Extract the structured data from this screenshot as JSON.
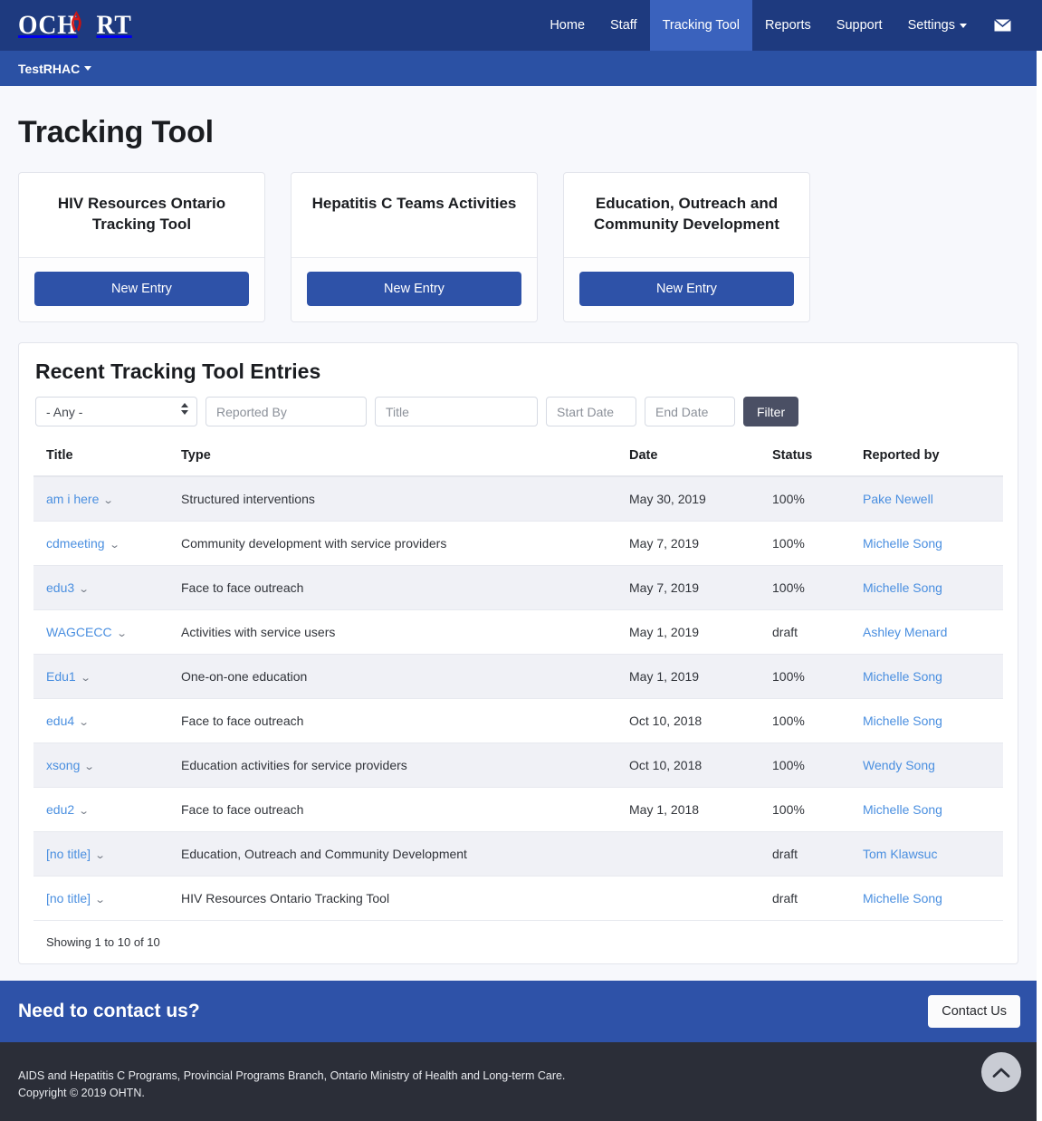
{
  "brand": {
    "logo_text": "OCH RT",
    "logo_before": "OCH",
    "logo_after": "RT",
    "ribbon_icon": "aids-ribbon-icon"
  },
  "colors": {
    "navbar": "#1e3a7f",
    "subbar": "#2b51a4",
    "active_nav": "#3a62bd",
    "primary_button": "#2e52a8",
    "filter_button": "#4a4f64",
    "link": "#4a8fe0",
    "page_background": "#f7f8fc",
    "footer": "#2b2e38",
    "row_stripe": "#f0f1f6",
    "scroll_top": "#c9ccd4"
  },
  "nav": {
    "items": [
      {
        "label": "Home",
        "active": false
      },
      {
        "label": "Staff",
        "active": false
      },
      {
        "label": "Tracking Tool",
        "active": true
      },
      {
        "label": "Reports",
        "active": false
      },
      {
        "label": "Support",
        "active": false
      },
      {
        "label": "Settings",
        "active": false,
        "has_caret": true
      }
    ],
    "mail_icon": "envelope-icon"
  },
  "subbar": {
    "org_label": "TestRHAC",
    "caret_icon": "caret-down-icon"
  },
  "header": {
    "page_title": "Tracking Tool"
  },
  "tool_cards": [
    {
      "title": "HIV Resources Ontario Tracking Tool",
      "button_label": "New Entry"
    },
    {
      "title": "Hepatitis C Teams Activities",
      "button_label": "New Entry"
    },
    {
      "title": "Education, Outreach and Community Development",
      "button_label": "New Entry"
    }
  ],
  "panel": {
    "title": "Recent Tracking Tool Entries",
    "filters": {
      "type_select": {
        "selected": "- Any -",
        "options": [
          "- Any -"
        ]
      },
      "reported_by_placeholder": "Reported By",
      "reported_by_value": "",
      "title_placeholder": "Title",
      "title_value": "",
      "start_date_placeholder": "Start Date",
      "start_date_value": "",
      "end_date_placeholder": "End Date",
      "end_date_value": "",
      "filter_button": "Filter"
    },
    "table": {
      "columns": [
        "Title",
        "Type",
        "Date",
        "Status",
        "Reported by"
      ],
      "rows": [
        {
          "title": "am i here",
          "type": "Structured interventions",
          "date": "May 30, 2019",
          "status": "100%",
          "reported_by": "Pake Newell"
        },
        {
          "title": "cdmeeting",
          "type": "Community development with service providers",
          "date": "May 7, 2019",
          "status": "100%",
          "reported_by": "Michelle Song"
        },
        {
          "title": "edu3",
          "type": "Face to face outreach",
          "date": "May 7, 2019",
          "status": "100%",
          "reported_by": "Michelle Song"
        },
        {
          "title": "WAGCECC",
          "type": "Activities with service users",
          "date": "May 1, 2019",
          "status": "draft",
          "reported_by": "Ashley Menard"
        },
        {
          "title": "Edu1",
          "type": "One-on-one education",
          "date": "May 1, 2019",
          "status": "100%",
          "reported_by": "Michelle Song"
        },
        {
          "title": "edu4",
          "type": "Face to face outreach",
          "date": "Oct 10, 2018",
          "status": "100%",
          "reported_by": "Michelle Song"
        },
        {
          "title": "xsong",
          "type": "Education activities for service providers",
          "date": "Oct 10, 2018",
          "status": "100%",
          "reported_by": "Wendy Song"
        },
        {
          "title": "edu2",
          "type": "Face to face outreach",
          "date": "May 1, 2018",
          "status": "100%",
          "reported_by": "Michelle Song"
        },
        {
          "title": "[no title]",
          "type": "Education, Outreach and Community Development",
          "date": "",
          "status": "draft",
          "reported_by": "Tom Klawsuc"
        },
        {
          "title": "[no title]",
          "type": "HIV Resources Ontario Tracking Tool",
          "date": "",
          "status": "draft",
          "reported_by": "Michelle Song"
        }
      ],
      "showing": "Showing 1 to 10 of 10"
    }
  },
  "contact": {
    "prompt": "Need to contact us?",
    "button_label": "Contact Us"
  },
  "footer": {
    "line1": "AIDS and Hepatitis C Programs, Provincial Programs Branch, Ontario Ministry of Health and Long-term Care.",
    "line2": "Copyright © 2019 OHTN.",
    "scroll_top_icon": "chevron-up-icon"
  }
}
